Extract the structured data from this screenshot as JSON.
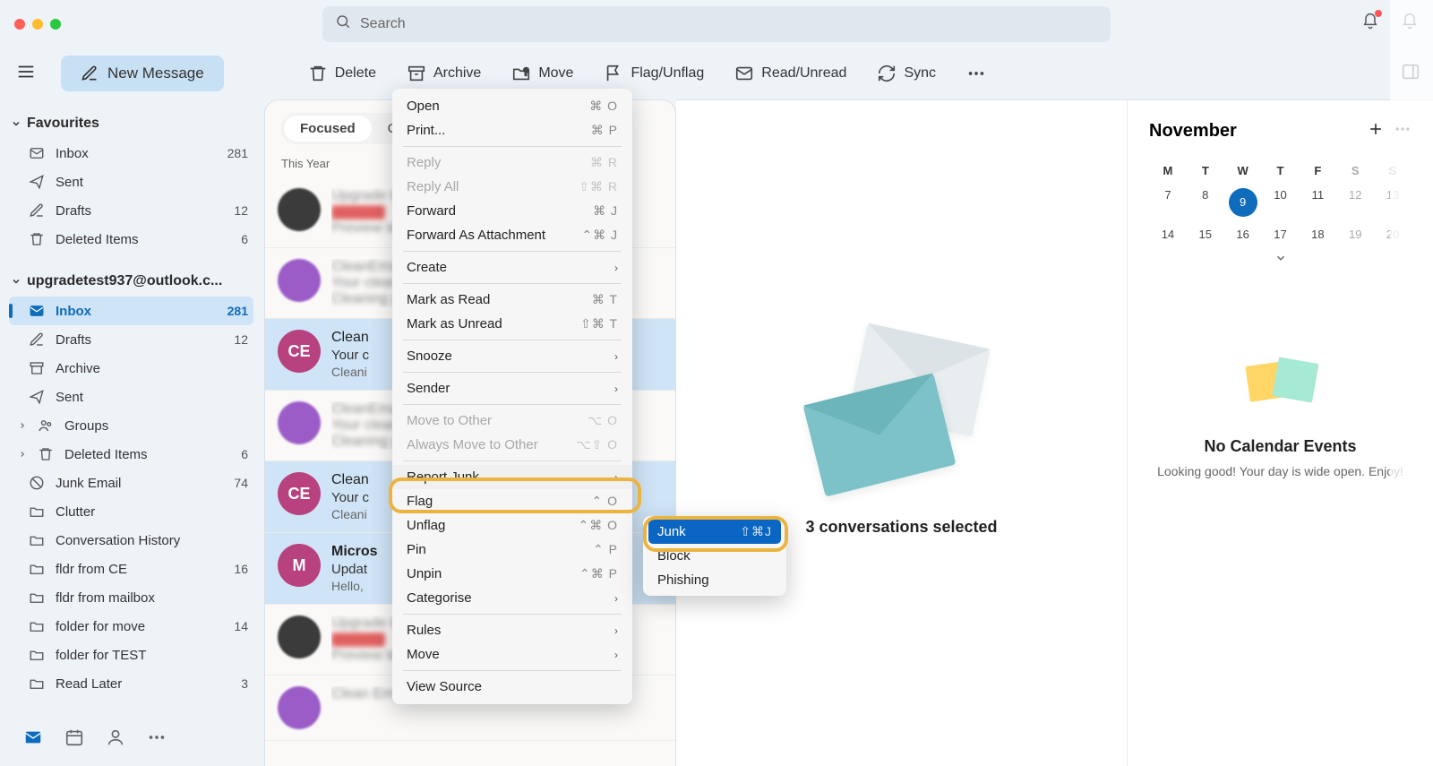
{
  "titlebar": {
    "search_placeholder": "Search"
  },
  "toolbar": {
    "new_message": "New Message",
    "delete": "Delete",
    "archive": "Archive",
    "move": "Move",
    "flag": "Flag/Unflag",
    "read": "Read/Unread",
    "sync": "Sync"
  },
  "sidebar": {
    "favourites": "Favourites",
    "account": "upgradetest937@outlook.c...",
    "inbox": "Inbox",
    "inbox_count": "281",
    "sent": "Sent",
    "drafts": "Drafts",
    "drafts_count": "12",
    "deleted": "Deleted Items",
    "deleted_count": "6",
    "archive": "Archive",
    "groups": "Groups",
    "deleted2_count": "6",
    "junk": "Junk Email",
    "junk_count": "74",
    "clutter": "Clutter",
    "conv_hist": "Conversation History",
    "fldr_ce": "fldr from CE",
    "fldr_ce_count": "16",
    "fldr_mb": "fldr from mailbox",
    "folder_move": "folder for move",
    "folder_move_count": "14",
    "folder_test": "folder for TEST",
    "read_later": "Read Later",
    "read_later_count": "3"
  },
  "list": {
    "focused": "Focused",
    "other": "Oth",
    "year_label": "This Year",
    "items": [
      {
        "sender_blur": "Upgrad",
        "preview": "Preve"
      },
      {
        "sender": "Clean",
        "subj": "Your",
        "prev": "Cleani"
      },
      {
        "sender": "Clean",
        "subj": "Your c",
        "prev": "Cleani",
        "avatar": "CE"
      },
      {
        "sender": "Clean",
        "subj": "Your",
        "prev": "Cleani"
      },
      {
        "sender": "Clean",
        "subj": "Your c",
        "prev": "Cleani",
        "avatar": "CE"
      },
      {
        "sender": "Micros",
        "subj": "Updat",
        "prev": "Hello,",
        "avatar": "M"
      },
      {
        "sender_blur": "Upgrad",
        "preview": "Preve"
      }
    ]
  },
  "reading": {
    "selected_text": "3 conversations selected"
  },
  "calendar": {
    "month": "November",
    "days_hd": [
      "M",
      "T",
      "W",
      "T",
      "F",
      "S",
      "S"
    ],
    "rows": [
      [
        "7",
        "8",
        "9",
        "10",
        "11",
        "12",
        "13"
      ],
      [
        "14",
        "15",
        "16",
        "17",
        "18",
        "19",
        "20"
      ]
    ],
    "today": "9",
    "empty_title": "No Calendar Events",
    "empty_text": "Looking good! Your day is wide open. Enjoy!"
  },
  "context_menu": {
    "open": "Open",
    "open_sc": "⌘ O",
    "print": "Print...",
    "print_sc": "⌘ P",
    "reply": "Reply",
    "reply_sc": "⌘ R",
    "reply_all": "Reply All",
    "reply_all_sc": "⇧⌘ R",
    "forward": "Forward",
    "forward_sc": "⌘ J",
    "forward_att": "Forward As Attachment",
    "forward_att_sc": "⌃⌘ J",
    "create": "Create",
    "mark_read": "Mark as Read",
    "mark_read_sc": "⌘ T",
    "mark_unread": "Mark as Unread",
    "mark_unread_sc": "⇧⌘ T",
    "snooze": "Snooze",
    "sender": "Sender",
    "move_other": "Move to Other",
    "move_other_sc": "⌥ O",
    "always_move": "Always Move to Other",
    "always_move_sc": "⌥⇧ O",
    "report_junk": "Report Junk",
    "flag": "Flag",
    "flag_sc": "⌃ O",
    "unflag": "Unflag",
    "unflag_sc": "⌃⌘ O",
    "pin": "Pin",
    "pin_sc": "⌃ P",
    "unpin": "Unpin",
    "unpin_sc": "⌃⌘ P",
    "categorise": "Categorise",
    "rules": "Rules",
    "move": "Move",
    "view_source": "View Source"
  },
  "junk_submenu": {
    "junk": "Junk",
    "junk_sc": "⇧⌘J",
    "block": "Block",
    "phishing": "Phishing"
  }
}
